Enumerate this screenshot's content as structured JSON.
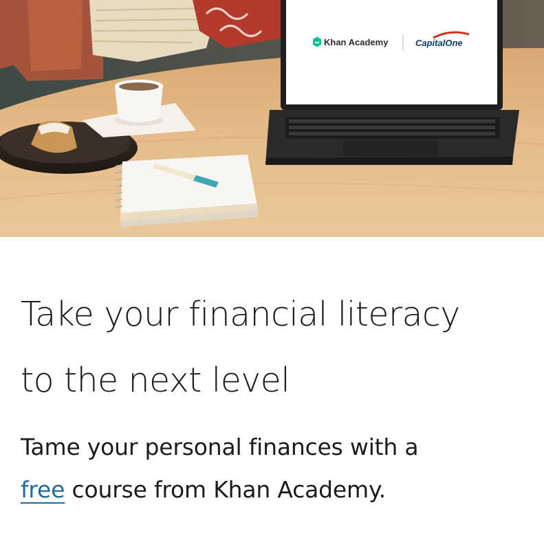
{
  "hero": {
    "alt": "Laptop on a cafe table showing Khan Academy and Capital One logos",
    "brand_khan": "Khan Academy",
    "brand_capital": "CapitalOne",
    "colors": {
      "table": "#e2b784",
      "laptop": "#2a2a2a",
      "screen": "#ffffff",
      "khan_green": "#14bf96",
      "capital_red": "#d22e1e",
      "capital_navy": "#0e3a66"
    }
  },
  "content": {
    "headline_line1": "Take your financial literacy",
    "headline_line2": "to the next level",
    "sub_prefix": "Tame your personal finances with a",
    "link_text": "free",
    "sub_suffix": " course from Khan Academy.",
    "link_color": "#1f6b9c"
  }
}
